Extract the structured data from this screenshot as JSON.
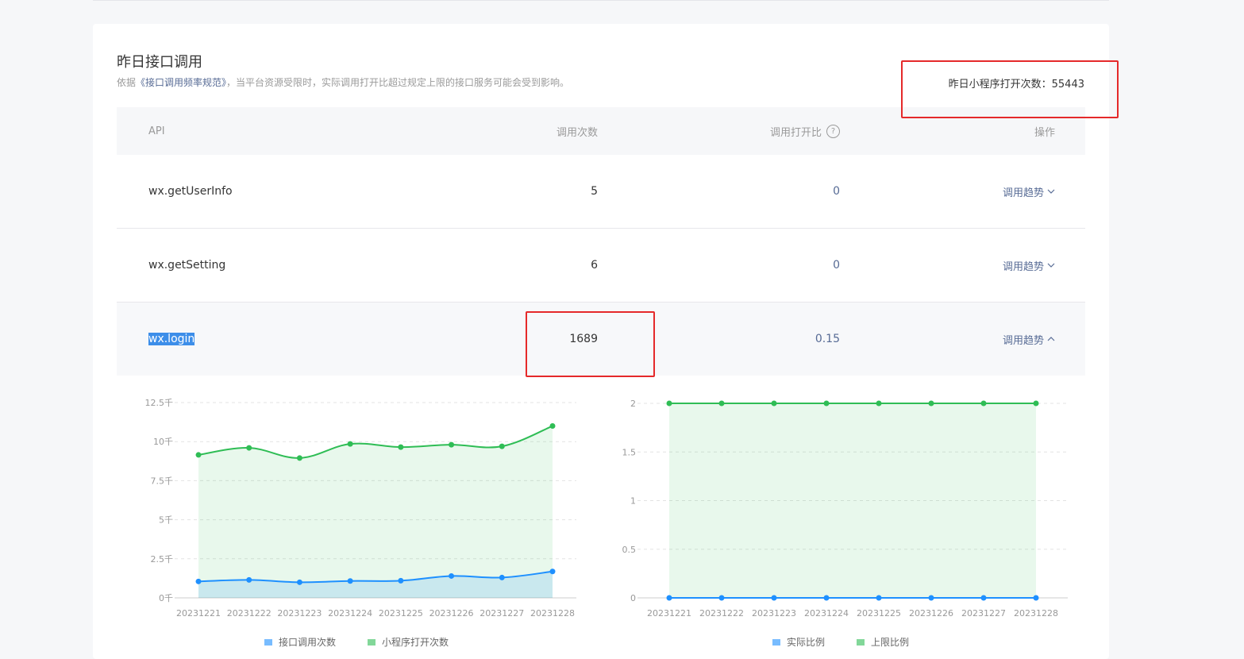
{
  "section": {
    "title": "昨日接口调用",
    "desc_prefix": "依据",
    "desc_link": "《接口调用频率规范》",
    "desc_suffix": "，当平台资源受限时，实际调用打开比超过规定上限的接口服务可能会受到影响。",
    "open_count_label": "昨日小程序打开次数：",
    "open_count_value": "55443"
  },
  "table": {
    "headers": {
      "api": "API",
      "calls": "调用次数",
      "ratio": "调用打开比",
      "op": "操作"
    },
    "help_glyph": "?",
    "rows": [
      {
        "api": "wx.getUserInfo",
        "calls": "5",
        "ratio": "0",
        "op": "调用趋势",
        "expanded": false
      },
      {
        "api": "wx.getSetting",
        "calls": "6",
        "ratio": "0",
        "op": "调用趋势",
        "expanded": false
      },
      {
        "api": "wx.login",
        "calls": "1689",
        "ratio": "0.15",
        "op": "调用趋势",
        "expanded": true
      }
    ]
  },
  "chart_data": [
    {
      "type": "area",
      "categories": [
        "20231221",
        "20231222",
        "20231223",
        "20231224",
        "20231225",
        "20231226",
        "20231227",
        "20231228"
      ],
      "y_ticks": [
        "0千",
        "2.5千",
        "5千",
        "7.5千",
        "10千",
        "12.5千"
      ],
      "ylim": [
        0,
        12500
      ],
      "series": [
        {
          "name": "接口调用次数",
          "color": "#1e90ff",
          "values": [
            1050,
            1150,
            1000,
            1080,
            1100,
            1400,
            1300,
            1689
          ]
        },
        {
          "name": "小程序打开次数",
          "color": "#2fbd55",
          "values": [
            9150,
            9600,
            8950,
            9850,
            9650,
            9800,
            9700,
            11000
          ]
        }
      ],
      "grid": true,
      "legend": "bottom-center"
    },
    {
      "type": "area",
      "categories": [
        "20231221",
        "20231222",
        "20231223",
        "20231224",
        "20231225",
        "20231226",
        "20231227",
        "20231228"
      ],
      "y_ticks": [
        "0",
        "0.5",
        "1",
        "1.5",
        "2"
      ],
      "ylim": [
        0,
        2
      ],
      "series": [
        {
          "name": "实际比例",
          "color": "#1e90ff",
          "values": [
            0,
            0,
            0,
            0,
            0,
            0,
            0,
            0
          ]
        },
        {
          "name": "上限比例",
          "color": "#2fbd55",
          "values": [
            2,
            2,
            2,
            2,
            2,
            2,
            2,
            2
          ]
        }
      ],
      "grid": true,
      "legend": "bottom-center"
    }
  ],
  "colors": {
    "link": "#576b95",
    "highlight_box": "#e5292a",
    "selection": "#3d8ee9",
    "series_blue": "#1e90ff",
    "series_green": "#2fbd55"
  }
}
